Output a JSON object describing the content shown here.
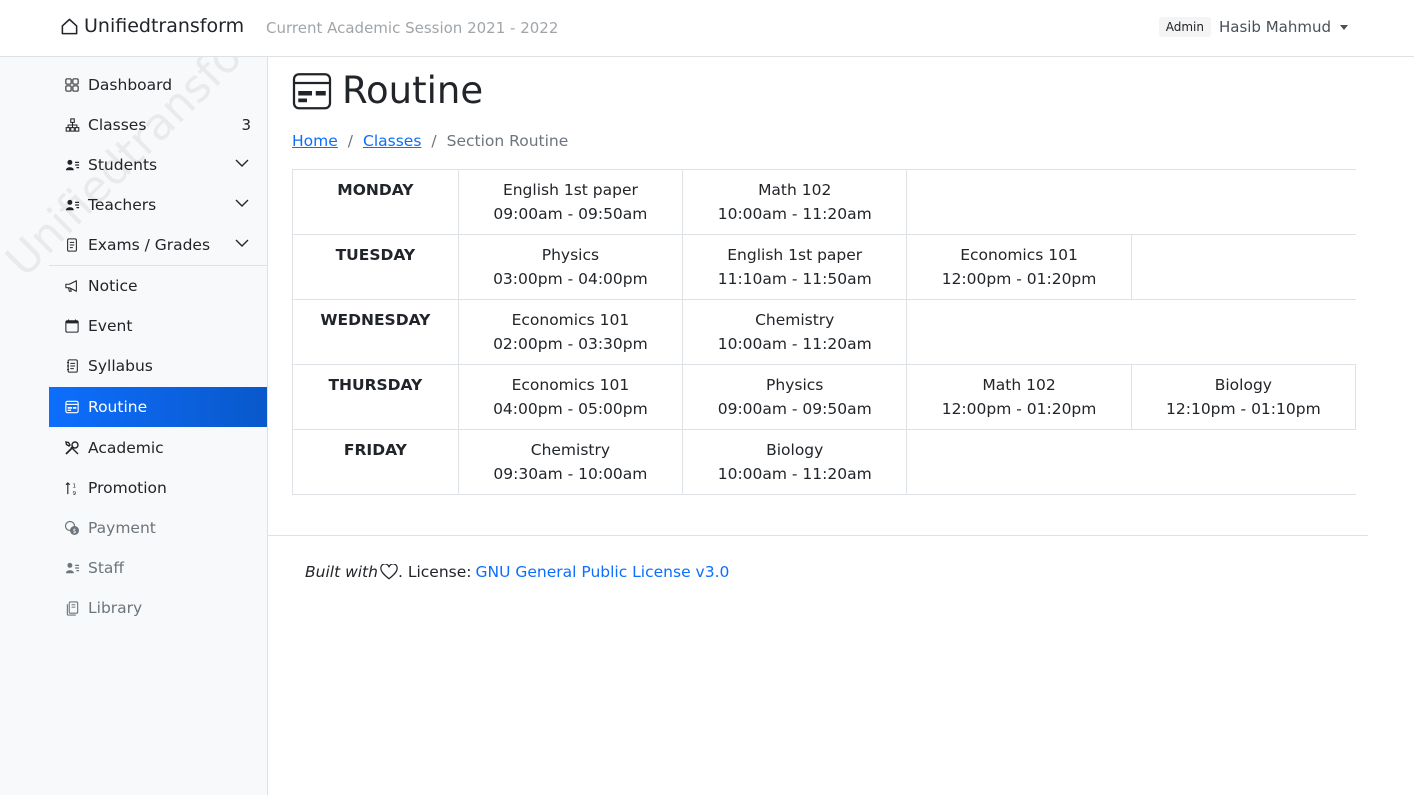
{
  "navbar": {
    "brand": "Unifiedtransform",
    "session": "Current Academic Session 2021 - 2022",
    "role": "Admin",
    "user_name": "Hasib Mahmud"
  },
  "sidebar": {
    "watermark": "Unifiedtransform",
    "items": [
      {
        "label": "Dashboard",
        "icon": "grid-icon"
      },
      {
        "label": "Classes",
        "icon": "diagram-icon",
        "count": "3"
      },
      {
        "label": "Students",
        "icon": "person-lines-icon",
        "expandable": true
      },
      {
        "label": "Teachers",
        "icon": "person-lines-icon",
        "expandable": true
      },
      {
        "label": "Exams / Grades",
        "icon": "file-text-icon",
        "expandable": true
      },
      {
        "label": "Notice",
        "icon": "megaphone-icon"
      },
      {
        "label": "Event",
        "icon": "calendar-icon"
      },
      {
        "label": "Syllabus",
        "icon": "journal-text-icon"
      },
      {
        "label": "Routine",
        "icon": "calendar-event-icon",
        "active": true
      },
      {
        "label": "Academic",
        "icon": "tools-icon"
      },
      {
        "label": "Promotion",
        "icon": "sort-numeric-icon"
      },
      {
        "label": "Payment",
        "icon": "cash-coin-icon",
        "muted": true
      },
      {
        "label": "Staff",
        "icon": "person-lines-icon",
        "muted": true
      },
      {
        "label": "Library",
        "icon": "journals-icon",
        "muted": true
      }
    ]
  },
  "page": {
    "title": "Routine",
    "breadcrumb": [
      "Home",
      "Classes",
      "Section Routine"
    ]
  },
  "routine": [
    {
      "day": "MONDAY",
      "slots": [
        {
          "course": "English 1st paper",
          "time": "09:00am - 09:50am"
        },
        {
          "course": "Math 102",
          "time": "10:00am - 11:20am"
        }
      ]
    },
    {
      "day": "TUESDAY",
      "slots": [
        {
          "course": "Physics",
          "time": "03:00pm - 04:00pm"
        },
        {
          "course": "English 1st paper",
          "time": "11:10am - 11:50am"
        },
        {
          "course": "Economics 101",
          "time": "12:00pm - 01:20pm"
        }
      ]
    },
    {
      "day": "WEDNESDAY",
      "slots": [
        {
          "course": "Economics 101",
          "time": "02:00pm - 03:30pm"
        },
        {
          "course": "Chemistry",
          "time": "10:00am - 11:20am"
        }
      ]
    },
    {
      "day": "THURSDAY",
      "slots": [
        {
          "course": "Economics 101",
          "time": "04:00pm - 05:00pm"
        },
        {
          "course": "Physics",
          "time": "09:00am - 09:50am"
        },
        {
          "course": "Math 102",
          "time": "12:00pm - 01:20pm"
        },
        {
          "course": "Biology",
          "time": "12:10pm - 01:10pm"
        }
      ]
    },
    {
      "day": "FRIDAY",
      "slots": [
        {
          "course": "Chemistry",
          "time": "09:30am - 10:00am"
        },
        {
          "course": "Biology",
          "time": "10:00am - 11:20am"
        }
      ]
    }
  ],
  "footer": {
    "built_with": "Built with",
    "license_prefix": ". License:",
    "license_link": "GNU General Public License v3.0"
  },
  "colors": {
    "accent": "#0d6efd",
    "active_gradient_end": "#0a58ca",
    "border": "#dee2e6",
    "sidebar_bg": "#f8f9fa"
  }
}
